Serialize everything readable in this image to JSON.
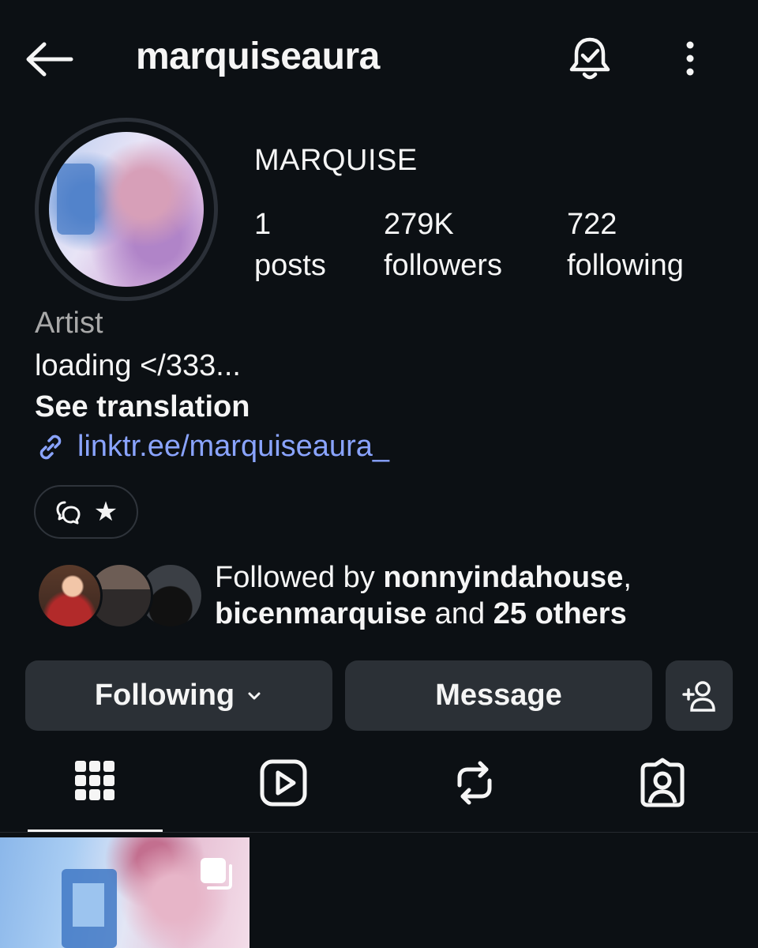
{
  "header": {
    "username": "marquiseaura"
  },
  "profile": {
    "display_name": "MARQUISE",
    "stats": [
      {
        "value": "1",
        "label": "posts"
      },
      {
        "value": "279K",
        "label": "followers"
      },
      {
        "value": "722",
        "label": "following"
      }
    ],
    "category": "Artist",
    "bio": "loading </333...",
    "see_translation": "See translation",
    "link": "linktr.ee/marquiseaura_",
    "threads_badge_star": "★"
  },
  "followed_by": {
    "prefix": "Followed by ",
    "user1": "nonnyindahouse",
    "sep": ",",
    "user2": "bicenmarquise",
    "and": " and ",
    "others": "25 others"
  },
  "buttons": {
    "following": "Following",
    "message": "Message"
  },
  "tabs": [
    {
      "icon": "grid-icon",
      "active": true
    },
    {
      "icon": "reels-icon",
      "active": false
    },
    {
      "icon": "reposts-icon",
      "active": false
    },
    {
      "icon": "tagged-icon",
      "active": false
    }
  ],
  "colors": {
    "background": "#0c1014",
    "button": "#2b3036",
    "link": "#8aa4ff",
    "muted": "#a8a8a8"
  }
}
